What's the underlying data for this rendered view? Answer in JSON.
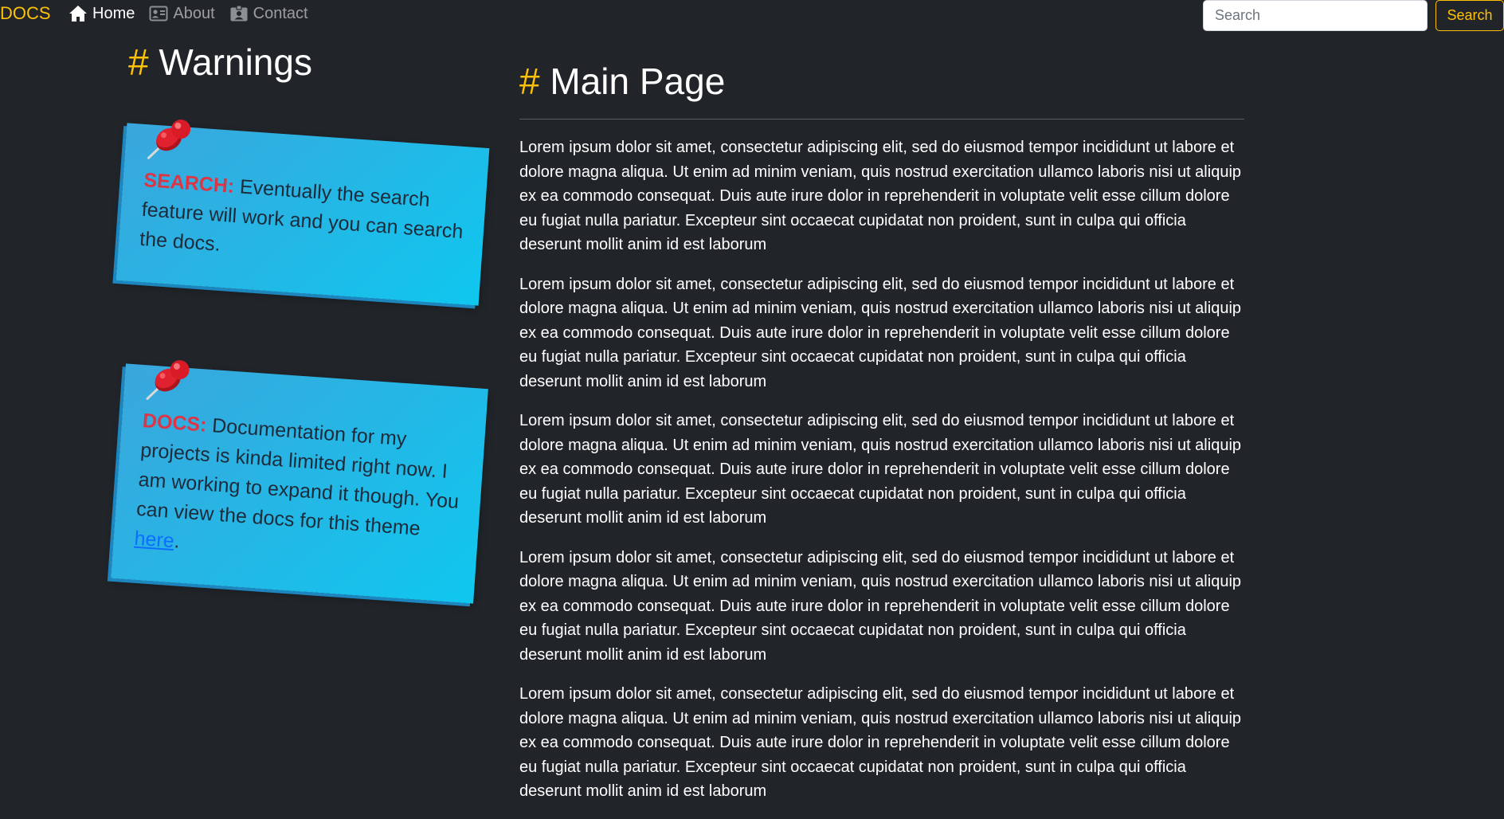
{
  "navbar": {
    "brand": "DOCS",
    "links": [
      {
        "label": "Home",
        "icon": "home-icon",
        "active": true
      },
      {
        "label": "About",
        "icon": "id-card-icon",
        "active": false
      },
      {
        "label": "Contact",
        "icon": "contact-badge-icon",
        "active": false
      }
    ],
    "search": {
      "placeholder": "Search",
      "button_label": "Search"
    }
  },
  "sidebar": {
    "hash": "#",
    "title": "Warnings",
    "notes": [
      {
        "label": "SEARCH:",
        "text": " Eventually the search feature will work and you can search the docs."
      },
      {
        "label": "DOCS:",
        "text": " Documentation for my projects is kinda limited right now. I am working to expand it though. You can view the docs for this theme ",
        "link_text": "here",
        "trailing": "."
      }
    ]
  },
  "main": {
    "hash": "#",
    "title": "Main Page",
    "paragraphs": [
      "Lorem ipsum dolor sit amet, consectetur adipiscing elit, sed do eiusmod tempor incididunt ut labore et dolore magna aliqua. Ut enim ad minim veniam, quis nostrud exercitation ullamco laboris nisi ut aliquip ex ea commodo consequat. Duis aute irure dolor in reprehenderit in voluptate velit esse cillum dolore eu fugiat nulla pariatur. Excepteur sint occaecat cupidatat non proident, sunt in culpa qui officia deserunt mollit anim id est laborum",
      "Lorem ipsum dolor sit amet, consectetur adipiscing elit, sed do eiusmod tempor incididunt ut labore et dolore magna aliqua. Ut enim ad minim veniam, quis nostrud exercitation ullamco laboris nisi ut aliquip ex ea commodo consequat. Duis aute irure dolor in reprehenderit in voluptate velit esse cillum dolore eu fugiat nulla pariatur. Excepteur sint occaecat cupidatat non proident, sunt in culpa qui officia deserunt mollit anim id est laborum",
      "Lorem ipsum dolor sit amet, consectetur adipiscing elit, sed do eiusmod tempor incididunt ut labore et dolore magna aliqua. Ut enim ad minim veniam, quis nostrud exercitation ullamco laboris nisi ut aliquip ex ea commodo consequat. Duis aute irure dolor in reprehenderit in voluptate velit esse cillum dolore eu fugiat nulla pariatur. Excepteur sint occaecat cupidatat non proident, sunt in culpa qui officia deserunt mollit anim id est laborum",
      "Lorem ipsum dolor sit amet, consectetur adipiscing elit, sed do eiusmod tempor incididunt ut labore et dolore magna aliqua. Ut enim ad minim veniam, quis nostrud exercitation ullamco laboris nisi ut aliquip ex ea commodo consequat. Duis aute irure dolor in reprehenderit in voluptate velit esse cillum dolore eu fugiat nulla pariatur. Excepteur sint occaecat cupidatat non proident, sunt in culpa qui officia deserunt mollit anim id est laborum",
      "Lorem ipsum dolor sit amet, consectetur adipiscing elit, sed do eiusmod tempor incididunt ut labore et dolore magna aliqua. Ut enim ad minim veniam, quis nostrud exercitation ullamco laboris nisi ut aliquip ex ea commodo consequat. Duis aute irure dolor in reprehenderit in voluptate velit esse cillum dolore eu fugiat nulla pariatur. Excepteur sint occaecat cupidatat non proident, sunt in culpa qui officia deserunt mollit anim id est laborum"
    ]
  },
  "colors": {
    "background": "#212529",
    "accent": "#ffc107",
    "note_blue": "#23b8e6",
    "warning_red": "#dc3545",
    "link_blue": "#0d6efd"
  }
}
